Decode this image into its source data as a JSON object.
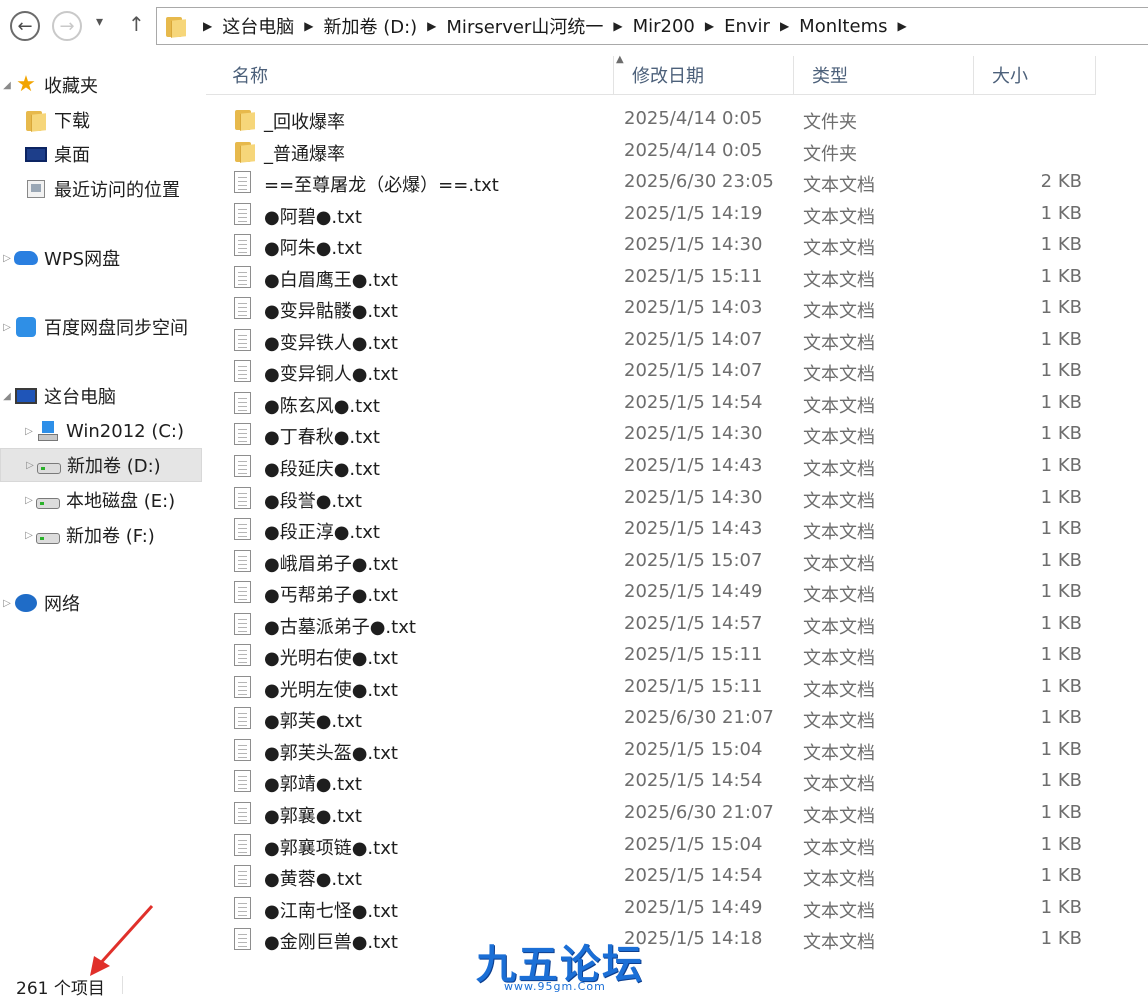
{
  "address_bar": {
    "breadcrumbs": [
      "这台电脑",
      "新加卷 (D:)",
      "Mirserver山河统一",
      "Mir200",
      "Envir",
      "MonItems"
    ]
  },
  "sidebar": {
    "items": [
      {
        "label": "收藏夹",
        "icon": "star-icon"
      },
      {
        "label": "下载",
        "icon": "download-folder-icon"
      },
      {
        "label": "桌面",
        "icon": "desktop-icon"
      },
      {
        "label": "最近访问的位置",
        "icon": "recent-places-icon"
      },
      {
        "label": "WPS网盘",
        "icon": "cloud-icon"
      },
      {
        "label": "百度网盘同步空间",
        "icon": "baidu-netdisk-icon"
      },
      {
        "label": "这台电脑",
        "icon": "computer-icon"
      },
      {
        "label": "Win2012 (C:)",
        "icon": "system-drive-icon"
      },
      {
        "label": "新加卷 (D:)",
        "icon": "drive-icon"
      },
      {
        "label": "本地磁盘 (E:)",
        "icon": "drive-icon"
      },
      {
        "label": "新加卷 (F:)",
        "icon": "drive-icon"
      },
      {
        "label": "网络",
        "icon": "network-icon"
      }
    ]
  },
  "columns": {
    "name": "名称",
    "date": "修改日期",
    "type": "类型",
    "size": "大小"
  },
  "files": [
    {
      "name": "_回收爆率",
      "date": "2025/4/14 0:05",
      "type": "文件夹",
      "size": "",
      "kind": "folder"
    },
    {
      "name": "_普通爆率",
      "date": "2025/4/14 0:05",
      "type": "文件夹",
      "size": "",
      "kind": "folder"
    },
    {
      "name": "==至尊屠龙（必爆）==.txt",
      "date": "2025/6/30 23:05",
      "type": "文本文档",
      "size": "2 KB",
      "kind": "txt"
    },
    {
      "name": "●阿碧●.txt",
      "date": "2025/1/5 14:19",
      "type": "文本文档",
      "size": "1 KB",
      "kind": "txt"
    },
    {
      "name": "●阿朱●.txt",
      "date": "2025/1/5 14:30",
      "type": "文本文档",
      "size": "1 KB",
      "kind": "txt"
    },
    {
      "name": "●白眉鹰王●.txt",
      "date": "2025/1/5 15:11",
      "type": "文本文档",
      "size": "1 KB",
      "kind": "txt"
    },
    {
      "name": "●变异骷髅●.txt",
      "date": "2025/1/5 14:03",
      "type": "文本文档",
      "size": "1 KB",
      "kind": "txt"
    },
    {
      "name": "●变异铁人●.txt",
      "date": "2025/1/5 14:07",
      "type": "文本文档",
      "size": "1 KB",
      "kind": "txt"
    },
    {
      "name": "●变异铜人●.txt",
      "date": "2025/1/5 14:07",
      "type": "文本文档",
      "size": "1 KB",
      "kind": "txt"
    },
    {
      "name": "●陈玄风●.txt",
      "date": "2025/1/5 14:54",
      "type": "文本文档",
      "size": "1 KB",
      "kind": "txt"
    },
    {
      "name": "●丁春秋●.txt",
      "date": "2025/1/5 14:30",
      "type": "文本文档",
      "size": "1 KB",
      "kind": "txt"
    },
    {
      "name": "●段延庆●.txt",
      "date": "2025/1/5 14:43",
      "type": "文本文档",
      "size": "1 KB",
      "kind": "txt"
    },
    {
      "name": "●段誉●.txt",
      "date": "2025/1/5 14:30",
      "type": "文本文档",
      "size": "1 KB",
      "kind": "txt"
    },
    {
      "name": "●段正淳●.txt",
      "date": "2025/1/5 14:43",
      "type": "文本文档",
      "size": "1 KB",
      "kind": "txt"
    },
    {
      "name": "●峨眉弟子●.txt",
      "date": "2025/1/5 15:07",
      "type": "文本文档",
      "size": "1 KB",
      "kind": "txt"
    },
    {
      "name": "●丐帮弟子●.txt",
      "date": "2025/1/5 14:49",
      "type": "文本文档",
      "size": "1 KB",
      "kind": "txt"
    },
    {
      "name": "●古墓派弟子●.txt",
      "date": "2025/1/5 14:57",
      "type": "文本文档",
      "size": "1 KB",
      "kind": "txt"
    },
    {
      "name": "●光明右使●.txt",
      "date": "2025/1/5 15:11",
      "type": "文本文档",
      "size": "1 KB",
      "kind": "txt"
    },
    {
      "name": "●光明左使●.txt",
      "date": "2025/1/5 15:11",
      "type": "文本文档",
      "size": "1 KB",
      "kind": "txt"
    },
    {
      "name": "●郭芙●.txt",
      "date": "2025/6/30 21:07",
      "type": "文本文档",
      "size": "1 KB",
      "kind": "txt"
    },
    {
      "name": "●郭芙头盔●.txt",
      "date": "2025/1/5 15:04",
      "type": "文本文档",
      "size": "1 KB",
      "kind": "txt"
    },
    {
      "name": "●郭靖●.txt",
      "date": "2025/1/5 14:54",
      "type": "文本文档",
      "size": "1 KB",
      "kind": "txt"
    },
    {
      "name": "●郭襄●.txt",
      "date": "2025/6/30 21:07",
      "type": "文本文档",
      "size": "1 KB",
      "kind": "txt"
    },
    {
      "name": "●郭襄项链●.txt",
      "date": "2025/1/5 15:04",
      "type": "文本文档",
      "size": "1 KB",
      "kind": "txt"
    },
    {
      "name": "●黄蓉●.txt",
      "date": "2025/1/5 14:54",
      "type": "文本文档",
      "size": "1 KB",
      "kind": "txt"
    },
    {
      "name": "●江南七怪●.txt",
      "date": "2025/1/5 14:49",
      "type": "文本文档",
      "size": "1 KB",
      "kind": "txt"
    },
    {
      "name": "●金刚巨兽●.txt",
      "date": "2025/1/5 14:18",
      "type": "文本文档",
      "size": "1 KB",
      "kind": "txt"
    }
  ],
  "status_bar": {
    "item_count": "261 个项目"
  },
  "watermark": {
    "title": "九五论坛",
    "url": "www.95gm.Com"
  },
  "colors": {
    "header_text": "#4c607a",
    "selection": "#e5e5e5",
    "annotation_arrow": "#e0302a",
    "watermark": "#1b6fd6"
  }
}
